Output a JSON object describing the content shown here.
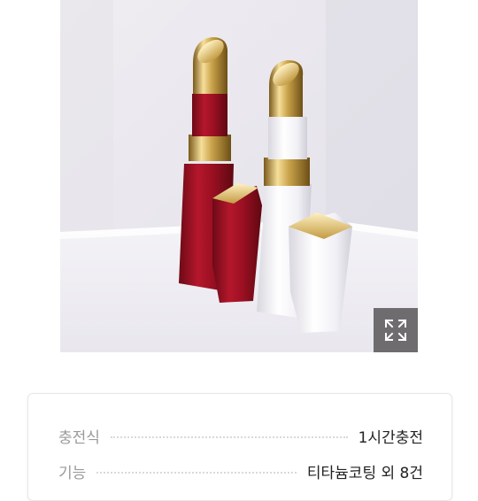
{
  "product_image": {
    "alt": "",
    "expand_icon": "expand-icon"
  },
  "specs": [
    {
      "label": "충전식",
      "value": "1시간충전"
    },
    {
      "label": "기능",
      "value": "티타늄코팅 외 8건"
    }
  ],
  "colors": {
    "expand_button_bg": "#6e6c6f",
    "product_red": "#9c1023",
    "product_white": "#f3f2f6",
    "gold": "#c9a24a"
  }
}
